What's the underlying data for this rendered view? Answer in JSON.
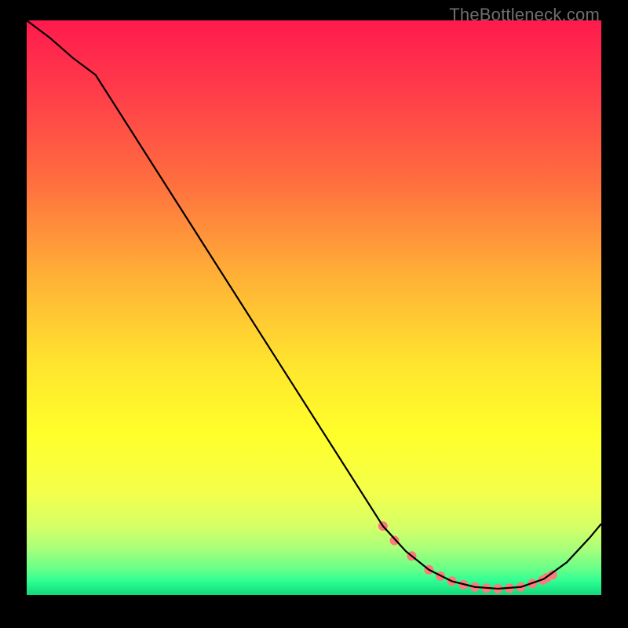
{
  "watermark": "TheBottleneck.com",
  "chart_data": {
    "type": "line",
    "title": "",
    "xlabel": "",
    "ylabel": "",
    "xlim": [
      0,
      100
    ],
    "ylim": [
      0,
      100
    ],
    "grid": false,
    "legend": false,
    "background_gradient_stops": [
      {
        "offset": 0.0,
        "color": "#ff1a4d"
      },
      {
        "offset": 0.12,
        "color": "#ff3b4a"
      },
      {
        "offset": 0.28,
        "color": "#ff6e3f"
      },
      {
        "offset": 0.45,
        "color": "#ffb236"
      },
      {
        "offset": 0.6,
        "color": "#ffe52e"
      },
      {
        "offset": 0.72,
        "color": "#ffff2a"
      },
      {
        "offset": 0.82,
        "color": "#f4ff4a"
      },
      {
        "offset": 0.88,
        "color": "#d6ff66"
      },
      {
        "offset": 0.92,
        "color": "#a8ff7a"
      },
      {
        "offset": 0.955,
        "color": "#66ff88"
      },
      {
        "offset": 0.975,
        "color": "#2fff94"
      },
      {
        "offset": 1.0,
        "color": "#12d97a"
      }
    ],
    "series": [
      {
        "name": "bottleneck-curve",
        "stroke": "#000000",
        "x": [
          0,
          4,
          8,
          12,
          62,
          66,
          70,
          74,
          78,
          82,
          86,
          90,
          94,
          98,
          100
        ],
        "y": [
          100,
          97,
          93.5,
          90.5,
          12,
          7.6,
          4.4,
          2.4,
          1.4,
          1.1,
          1.4,
          2.8,
          5.7,
          10.0,
          12.4
        ]
      }
    ],
    "markers": {
      "name": "highlight-dots",
      "fill": "#ff7a7a",
      "stroke": "#ff7a7a",
      "x": [
        62,
        64,
        67,
        70,
        72,
        74,
        76,
        78,
        80,
        82,
        84,
        86,
        88,
        89.8,
        90.5,
        91.5
      ],
      "y": [
        12.0,
        9.5,
        6.8,
        4.4,
        3.3,
        2.4,
        1.8,
        1.4,
        1.2,
        1.1,
        1.2,
        1.4,
        2.0,
        2.6,
        3.0,
        3.5
      ]
    }
  }
}
